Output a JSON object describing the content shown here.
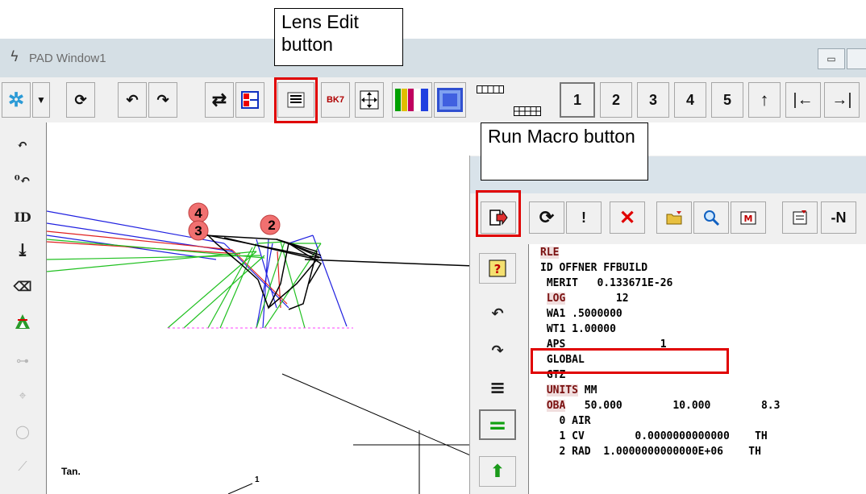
{
  "window": {
    "title": "PAD Window1",
    "minimize_symbol": "▭",
    "logo_icon": "lightning-icon"
  },
  "toolbar": {
    "buttons": [
      {
        "icon": "gear-icon"
      },
      {
        "icon": "dropdown-arrow-icon"
      },
      {
        "icon": "refresh-icon"
      },
      {
        "icon": "undo-icon"
      },
      {
        "icon": "redo-icon"
      },
      {
        "icon": "sliders-icon"
      },
      {
        "icon": "layout-icon"
      },
      {
        "icon": "lens-edit-icon"
      },
      {
        "icon": "bk7-glass-icon",
        "label": "BK7"
      },
      {
        "icon": "zoom-fit-icon"
      },
      {
        "icon": "color-bars-icon"
      },
      {
        "icon": "spot-diagram-icon"
      },
      {
        "icon": "table-icon"
      },
      {
        "icon": "grid-icon"
      }
    ],
    "page_buttons": [
      "1",
      "2",
      "3",
      "4",
      "5",
      "↑",
      "|←",
      "→|"
    ]
  },
  "annotations": {
    "lens_edit": "Lens Edit button",
    "run_macro": "Run Macro button"
  },
  "left_toolbar": {
    "items": [
      {
        "icon": "undo-icon",
        "label": "↶"
      },
      {
        "icon": "zero-undo-icon",
        "label": "⁰↶"
      },
      {
        "icon": "id-icon",
        "label": "ID"
      },
      {
        "icon": "download-icon",
        "label": "⤓"
      },
      {
        "icon": "eraser-icon",
        "label": "⌫"
      },
      {
        "icon": "tent-icon",
        "label": "⧗"
      },
      {
        "icon": "lens-element-icon",
        "label": "⊶"
      },
      {
        "icon": "crosshair-icon",
        "label": "⌖"
      },
      {
        "icon": "circle-icon",
        "label": "◯"
      },
      {
        "icon": "scale-icon",
        "label": "⟋"
      }
    ]
  },
  "plot": {
    "surface_labels": [
      "4",
      "3",
      "2"
    ],
    "tan_label": "Tan.",
    "ray_label": "1"
  },
  "macro_window": {
    "toolbar": [
      {
        "icon": "run-macro-icon"
      },
      {
        "icon": "cycle-icon"
      },
      {
        "icon": "exclamation-icon",
        "label": "!"
      },
      {
        "icon": "cross-icon"
      },
      {
        "icon": "open-folder-icon"
      },
      {
        "icon": "magnifier-icon"
      },
      {
        "icon": "movie-icon"
      },
      {
        "icon": "insert-icon"
      },
      {
        "icon": "negate-icon",
        "label": "-N"
      }
    ],
    "side_buttons": [
      {
        "icon": "help-icon",
        "label": "?"
      },
      {
        "icon": "undo-icon",
        "label": "↶"
      },
      {
        "icon": "redo-icon",
        "label": "↷"
      },
      {
        "icon": "align-right-icon",
        "label": "≡"
      },
      {
        "icon": "equals-icon",
        "label": "="
      },
      {
        "icon": "up-arrow-icon",
        "label": "⬆"
      }
    ],
    "editor_lines": [
      {
        "kw": "RLE",
        "rest": ""
      },
      {
        "kw": "",
        "rest": "ID OFFNER FFBUILD"
      },
      {
        "kw": "",
        "rest": " MERIT   0.133671E-26"
      },
      {
        "kw": "LOG",
        "rest": "        12",
        "indent": " "
      },
      {
        "kw": "",
        "rest": " WA1 .5000000"
      },
      {
        "kw": "",
        "rest": " WT1 1.00000"
      },
      {
        "kw": "",
        "rest": " APS               1"
      },
      {
        "kw": "",
        "rest": " GLOBAL"
      },
      {
        "kw": "",
        "rest": " GTZ"
      },
      {
        "kw": "UNITS",
        "rest": " MM",
        "indent": " "
      },
      {
        "kw": "OBA",
        "rest": "   50.000        10.000        8.3",
        "indent": " "
      },
      {
        "kw": "",
        "rest": "   0 AIR"
      },
      {
        "kw": "",
        "rest": "   1 CV        0.0000000000000    TH"
      },
      {
        "kw": "",
        "rest": "   2 RAD  1.0000000000000E+06    TH"
      }
    ]
  },
  "colors": {
    "highlight": "#e00000",
    "titlebar": "#d5dfe5",
    "keyword_bg": "#f0dede"
  }
}
